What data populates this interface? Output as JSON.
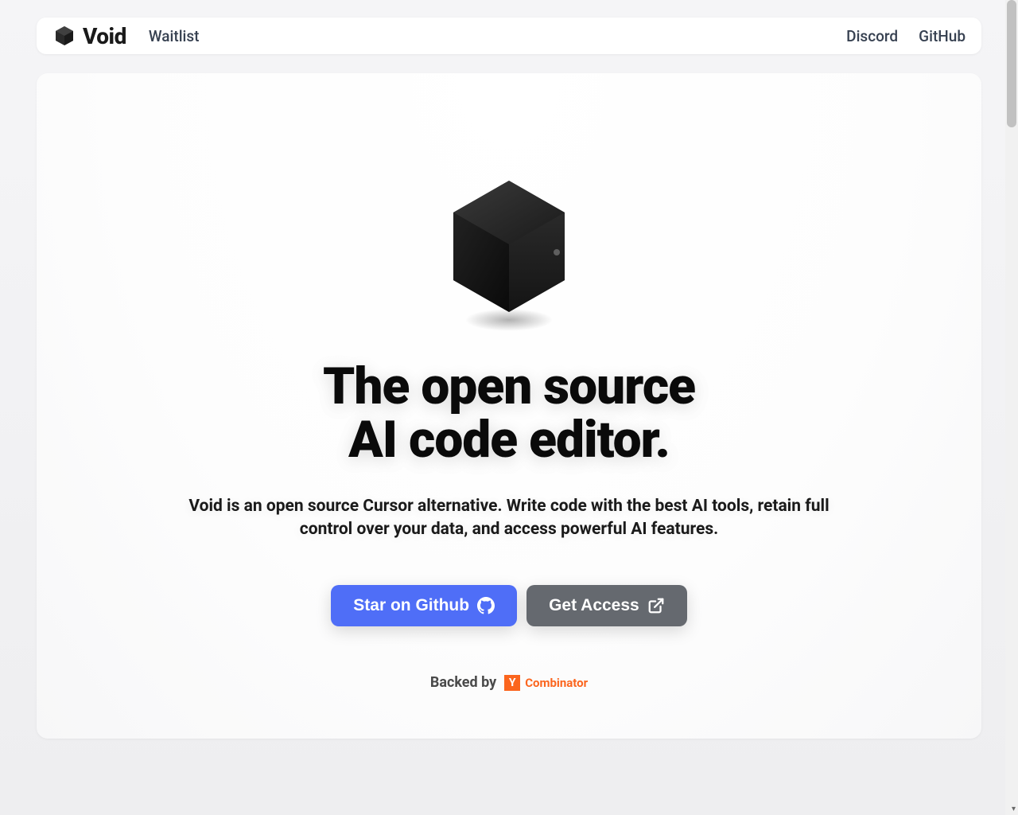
{
  "nav": {
    "brand": "Void",
    "links_left": [
      "Waitlist"
    ],
    "links_right": [
      "Discord",
      "GitHub"
    ]
  },
  "hero": {
    "headline_line1": "The open source",
    "headline_line2": "AI code editor.",
    "subheading": "Void is an open source Cursor alternative. Write code with the best AI tools, retain full control over your data, and access powerful AI features.",
    "cta_primary": "Star on Github",
    "cta_secondary": "Get Access",
    "backed_by_label": "Backed by",
    "yc_label": "Combinator"
  },
  "colors": {
    "primary_button": "#4f6ef7",
    "secondary_button": "#65696f",
    "yc_orange": "#fb651e"
  }
}
